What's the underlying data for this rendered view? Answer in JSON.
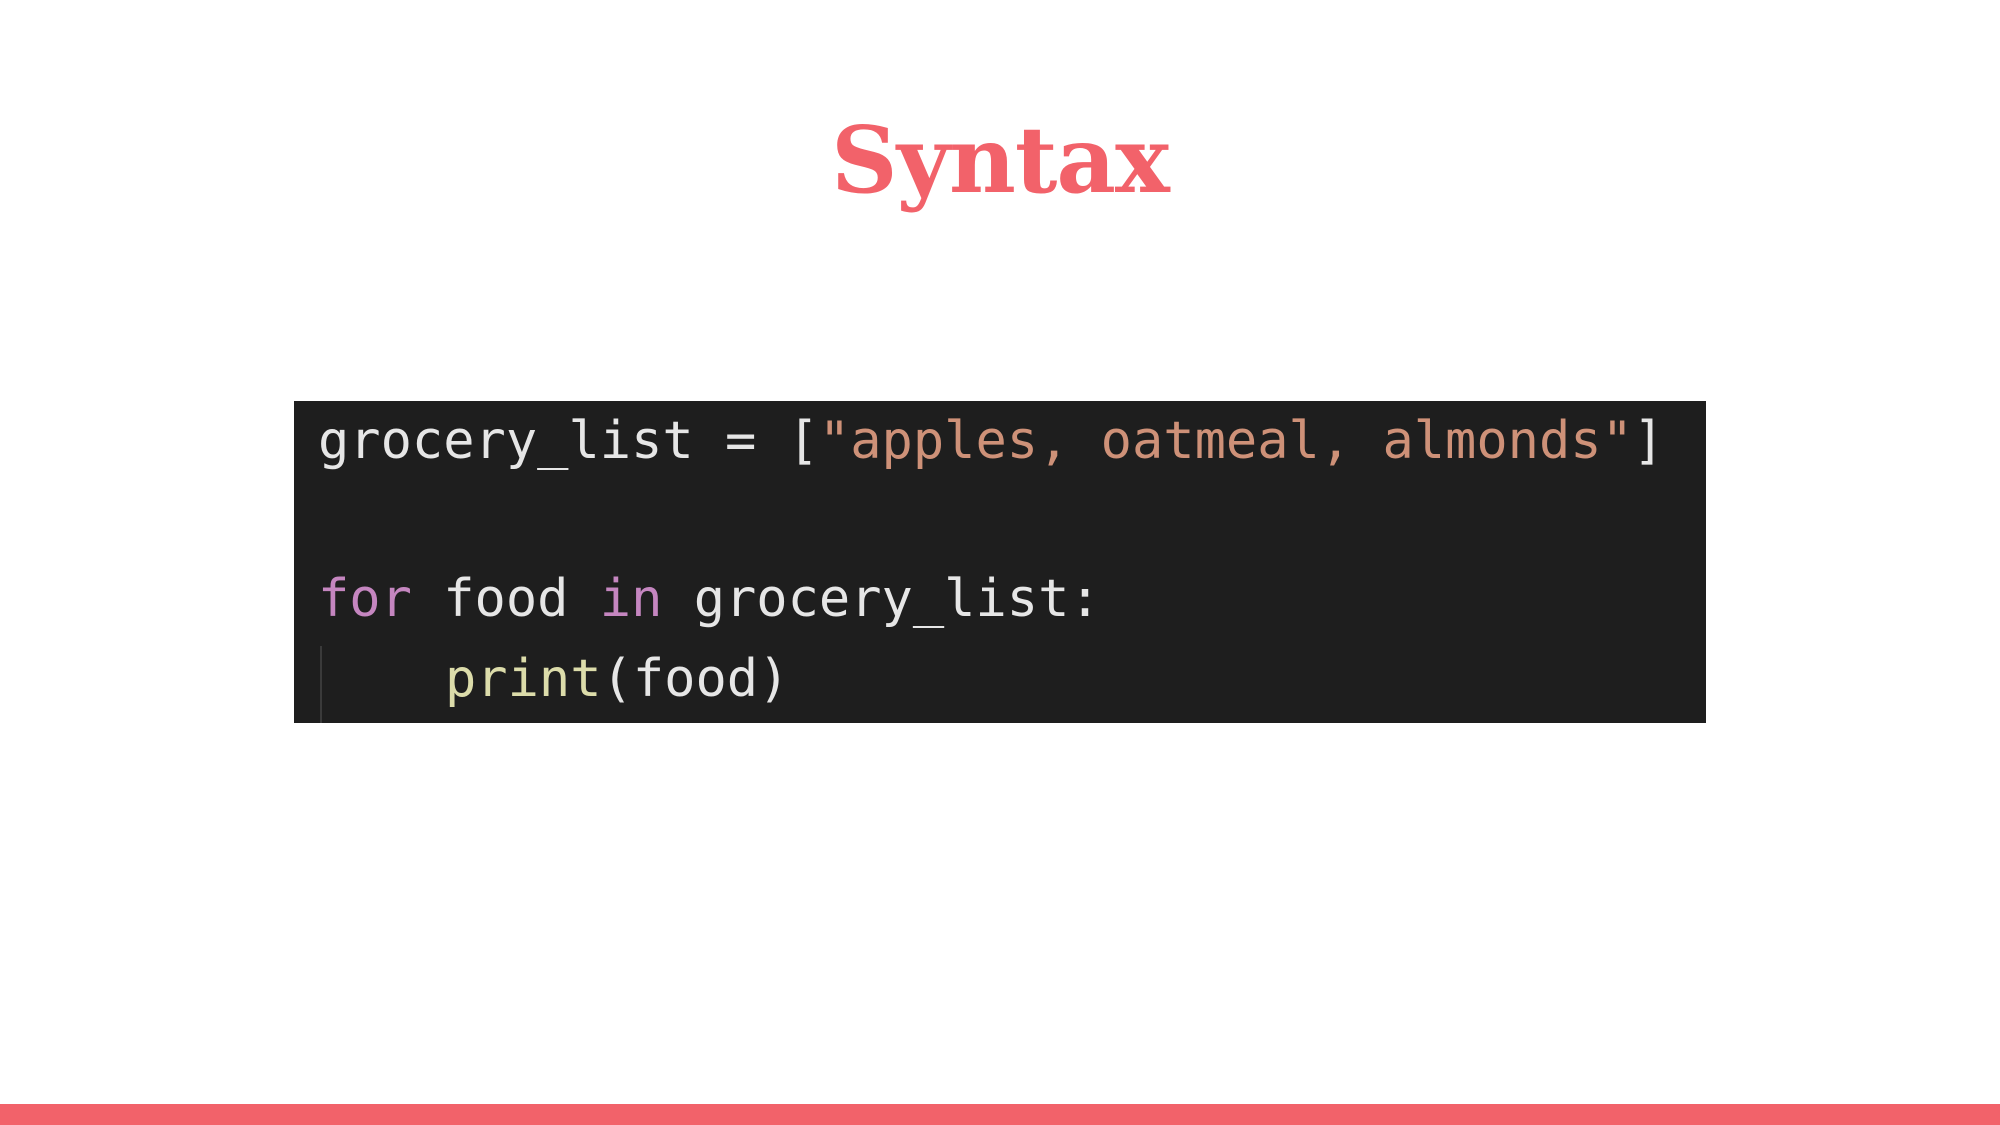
{
  "slide": {
    "title": "Syntax",
    "accent_color": "#f2626a"
  },
  "code": {
    "background_color": "#1e1e1e",
    "colors": {
      "plain": "#e6e6e6",
      "string": "#ce9178",
      "keyword": "#c586c0",
      "function": "#dcdcaa"
    },
    "line1": {
      "ident": "grocery_list",
      "op": " = [",
      "string": "\"apples, oatmeal, almonds\"",
      "close": "]"
    },
    "line2": {
      "kw_for": "for",
      "var": " food ",
      "kw_in": "in",
      "rest": " grocery_list:"
    },
    "line3": {
      "func": "print",
      "args": "(food)"
    }
  }
}
